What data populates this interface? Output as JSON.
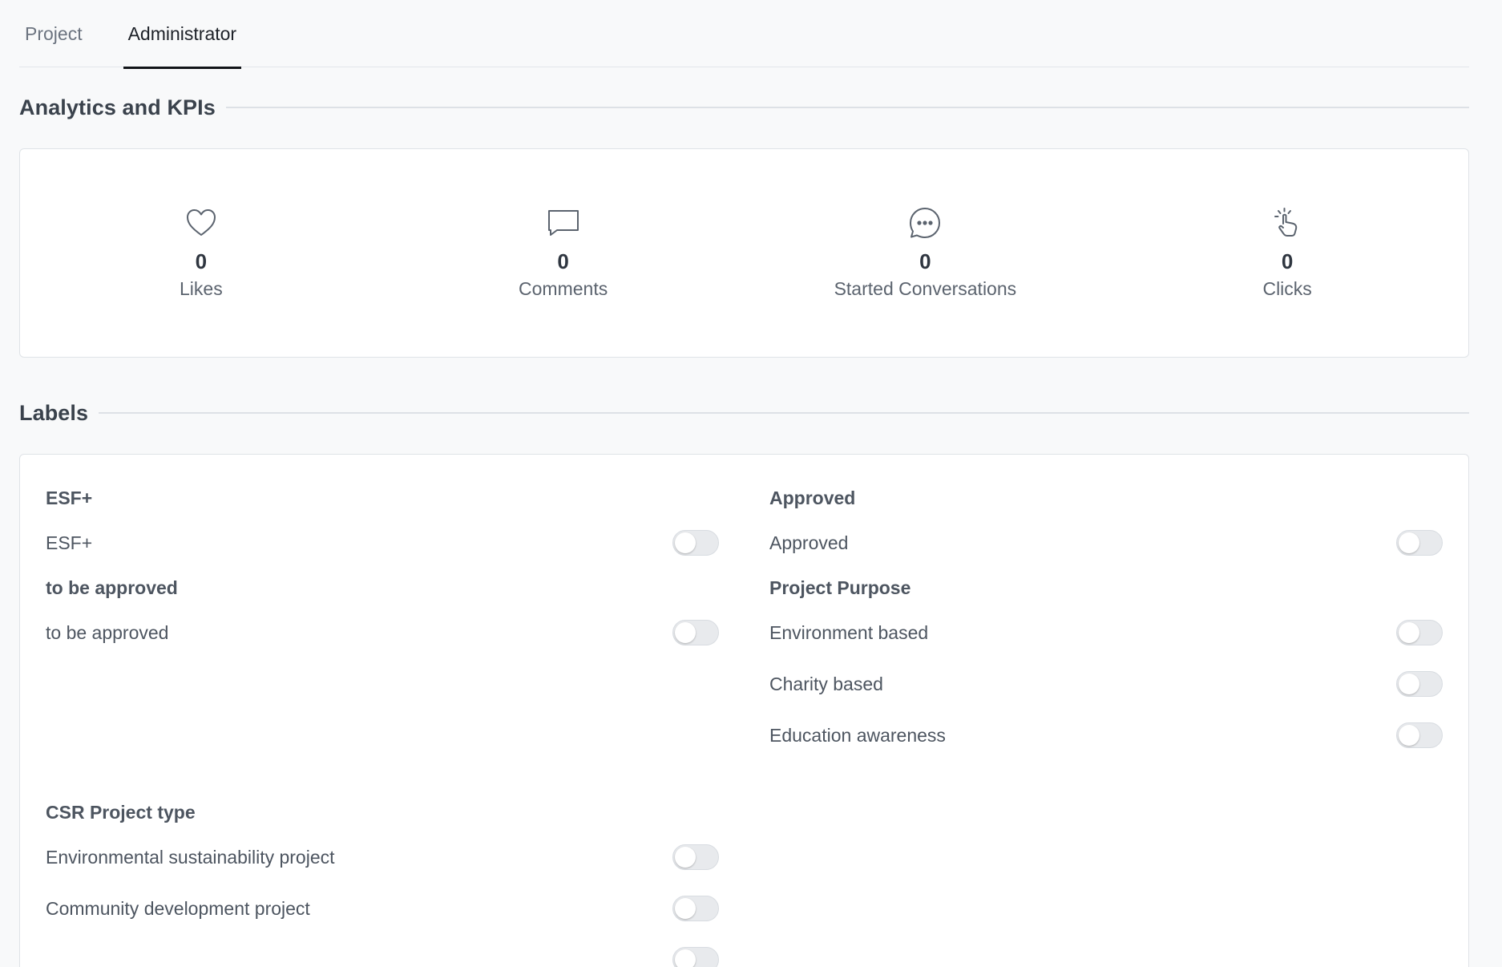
{
  "tabs": [
    {
      "label": "Project",
      "active": false
    },
    {
      "label": "Administrator",
      "active": true
    }
  ],
  "analytics": {
    "title": "Analytics and KPIs",
    "items": [
      {
        "icon": "heart-icon",
        "value": "0",
        "label": "Likes"
      },
      {
        "icon": "comment-icon",
        "value": "0",
        "label": "Comments"
      },
      {
        "icon": "chat-bubble-icon",
        "value": "0",
        "label": "Started Conversations"
      },
      {
        "icon": "click-icon",
        "value": "0",
        "label": "Clicks"
      }
    ]
  },
  "labels": {
    "title": "Labels",
    "groups": {
      "esf": {
        "title": "ESF+",
        "items": [
          {
            "label": "ESF+",
            "on": false
          }
        ]
      },
      "approved": {
        "title": "Approved",
        "items": [
          {
            "label": "Approved",
            "on": false
          }
        ]
      },
      "to_be_approved": {
        "title": "to be approved",
        "items": [
          {
            "label": "to be approved",
            "on": false
          }
        ]
      },
      "purpose": {
        "title": "Project Purpose",
        "items": [
          {
            "label": "Environment based",
            "on": false
          },
          {
            "label": "Charity based",
            "on": false
          },
          {
            "label": "Education awareness",
            "on": false
          }
        ]
      },
      "csr": {
        "title": "CSR Project type",
        "items": [
          {
            "label": "Environmental sustainability project",
            "on": false
          },
          {
            "label": "Community development project",
            "on": false
          }
        ]
      }
    }
  },
  "colors": {
    "background": "#f8f9fa",
    "card": "#ffffff",
    "tab_active": "#111418",
    "toggle_off": "#e8eaed"
  }
}
